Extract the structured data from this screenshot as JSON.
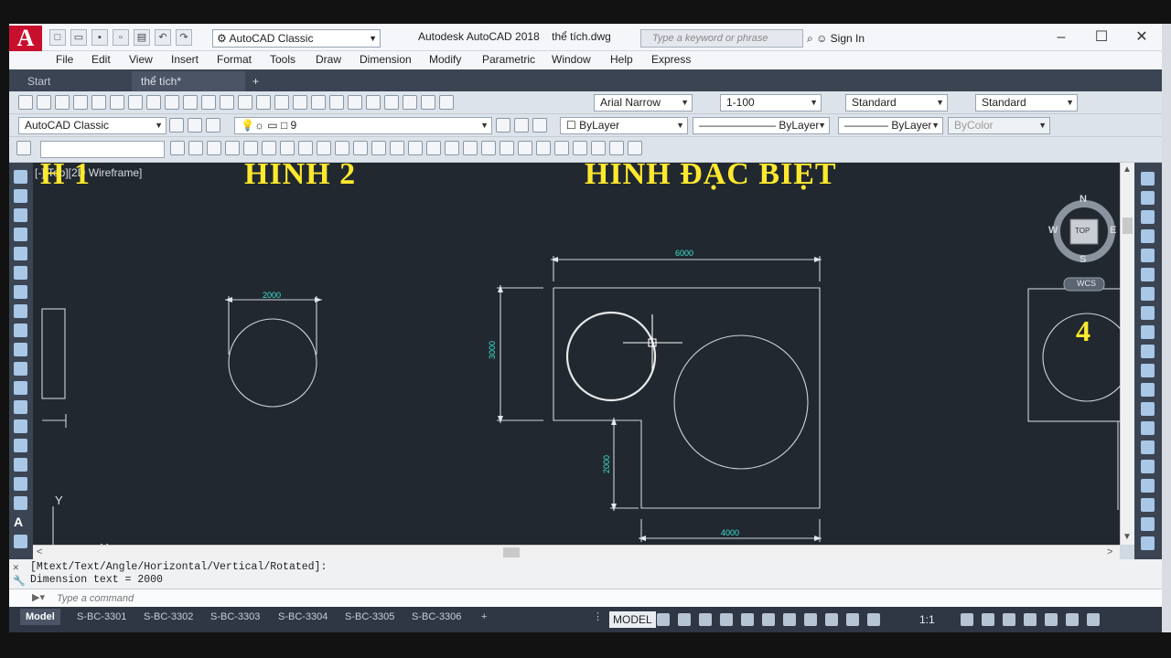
{
  "app": {
    "title": "Autodesk AutoCAD 2018",
    "filename": "thể tích.dwg",
    "logo_letter": "A"
  },
  "quick_access": {
    "workspace": "AutoCAD Classic"
  },
  "search": {
    "placeholder": "Type a keyword or phrase"
  },
  "account": {
    "sign_in": "Sign In"
  },
  "menu": [
    "File",
    "Edit",
    "View",
    "Insert",
    "Format",
    "Tools",
    "Draw",
    "Dimension",
    "Modify",
    "Parametric",
    "Window",
    "Help",
    "Express"
  ],
  "file_tabs": {
    "start": "Start",
    "active": "thể tích*"
  },
  "toolbar": {
    "text_style_font": "Arial Narrow",
    "dim_scale": "1-100",
    "dim_style": "Standard",
    "table_style": "Standard",
    "workspace": "AutoCAD Classic",
    "layer": "9",
    "color": "ByLayer",
    "linetype": "ByLayer",
    "lineweight": "ByLayer",
    "plotstyle": "ByColor"
  },
  "viewport": {
    "label": "[-][Top][2D Wireframe]",
    "titles": {
      "left": "H 1",
      "middle": "HÌNH 2",
      "right": "HÌNH ĐẶC BIỆT",
      "number": "4"
    },
    "dimensions": {
      "d_top": "6000",
      "d_left": "3000",
      "d_inner": "2000",
      "d_bottom": "4000",
      "d_circle": "2000"
    },
    "compass": {
      "n": "N",
      "s": "S",
      "e": "E",
      "w": "W",
      "top": "TOP",
      "wcs": "WCS"
    },
    "ucs": {
      "x": "X",
      "y": "Y"
    }
  },
  "command": {
    "history": [
      "[Mtext/Text/Angle/Horizontal/Vertical/Rotated]:",
      "Dimension text = 2000"
    ],
    "placeholder": "Type a command"
  },
  "layout_tabs": [
    "Model",
    "S-BC-3301",
    "S-BC-3302",
    "S-BC-3303",
    "S-BC-3304",
    "S-BC-3305",
    "S-BC-3306"
  ],
  "status": {
    "model": "MODEL",
    "scale": "1:1"
  }
}
